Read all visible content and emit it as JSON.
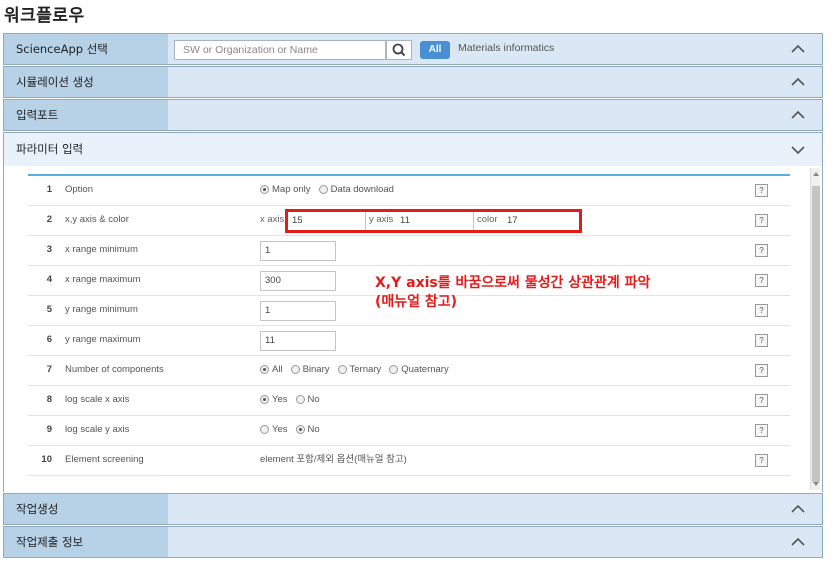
{
  "page_title": "워크플로우",
  "sections": {
    "scienceapp": {
      "label": "ScienceApp 선택",
      "search_placeholder": "SW or Organization or Name",
      "all_label": "All",
      "category": "Materials informatics"
    },
    "simulation": {
      "label": "시뮬레이션 생성"
    },
    "inputport": {
      "label": "입력포트"
    },
    "parameter": {
      "label": "파라미터 입력"
    },
    "job_create": {
      "label": "작업생성"
    },
    "job_submit": {
      "label": "작업제출 정보"
    }
  },
  "help_glyph": "?",
  "params": [
    {
      "num": "1",
      "name": "Option",
      "options": [
        "Map only",
        "Data download"
      ],
      "selected": 0
    },
    {
      "num": "2",
      "name": "x,y axis & color",
      "x_label": "x axis",
      "x_value": "15",
      "y_label": "y axis",
      "y_value": "11",
      "color_label": "color",
      "color_value": "17"
    },
    {
      "num": "3",
      "name": "x range minimum",
      "value": "1"
    },
    {
      "num": "4",
      "name": "x range maximum",
      "value": "300"
    },
    {
      "num": "5",
      "name": "y range minimum",
      "value": "1"
    },
    {
      "num": "6",
      "name": "y range maximum",
      "value": "11"
    },
    {
      "num": "7",
      "name": "Number of components",
      "options": [
        "All",
        "Binary",
        "Ternary",
        "Quaternary"
      ],
      "selected": 0
    },
    {
      "num": "8",
      "name": "log scale x axis",
      "options": [
        "Yes",
        "No"
      ],
      "selected": 0
    },
    {
      "num": "9",
      "name": "log scale y axis",
      "options": [
        "Yes",
        "No"
      ],
      "selected": 1
    },
    {
      "num": "10",
      "name": "Element screening",
      "text": "element 포함/제외 옵션(매뉴얼 참고)"
    }
  ],
  "annotation": {
    "line1": "X,Y axis를 바꿈으로써 물성간 상관관계 파악",
    "line2": "(매뉴얼 참고)",
    "color": "#e21b1b"
  },
  "colors": {
    "accent": "#4a8fd3",
    "header_bg": "#b7d1e6",
    "row_bg": "#d9e8f4",
    "annotation": "#e21b1b"
  }
}
